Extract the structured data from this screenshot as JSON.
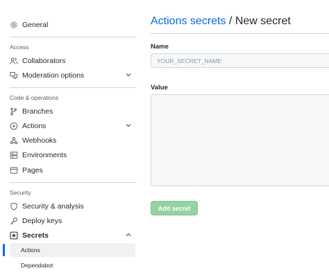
{
  "sidebar": {
    "general": "General",
    "access_heading": "Access",
    "collaborators": "Collaborators",
    "moderation": "Moderation options",
    "code_ops_heading": "Code & operations",
    "branches": "Branches",
    "actions": "Actions",
    "webhooks": "Webhooks",
    "environments": "Environments",
    "pages": "Pages",
    "security_heading": "Security",
    "security_analysis": "Security & analysis",
    "deploy_keys": "Deploy keys",
    "secrets": "Secrets",
    "secrets_sub": [
      "Actions",
      "Dependabot"
    ]
  },
  "main": {
    "title_link": "Actions secrets",
    "title_sep": " / ",
    "title_tail": "New secret",
    "name_label": "Name",
    "name_placeholder": "YOUR_SECRET_NAME",
    "value_label": "Value",
    "add_button": "Add secret"
  },
  "colors": {
    "accent": "#0969da",
    "button_disabled": "#94d3a2"
  }
}
